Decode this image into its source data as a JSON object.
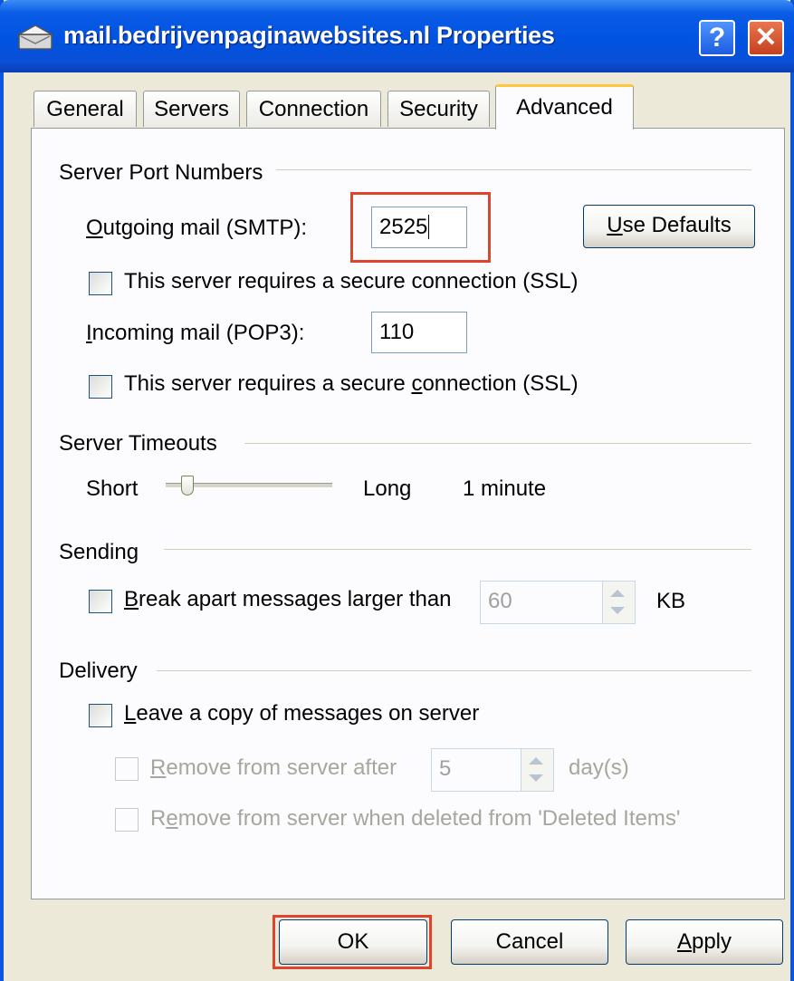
{
  "window": {
    "title": "mail.bedrijvenpaginawebsites.nl Properties",
    "help_label": "?",
    "close_label": "✕"
  },
  "tabs": [
    {
      "label": "General"
    },
    {
      "label": "Servers"
    },
    {
      "label": "Connection"
    },
    {
      "label": "Security"
    },
    {
      "label": "Advanced"
    }
  ],
  "ports": {
    "group_title": "Server Port Numbers",
    "outgoing_mnemonic": "O",
    "outgoing_rest": "utgoing mail (SMTP):",
    "outgoing_value": "2525",
    "use_defaults_mnemonic": "U",
    "use_defaults_rest": "se Defaults",
    "ssl1_label": "This server requires a secure connection (SSL)",
    "incoming_mnemonic": "I",
    "incoming_rest": "ncoming mail (POP3):",
    "incoming_value": "110",
    "ssl2_before": "This server requires a secure ",
    "ssl2_mnemonic": "c",
    "ssl2_after": "onnection (SSL)"
  },
  "timeouts": {
    "group_title": "Server Timeouts",
    "short_label": "Short",
    "long_label": "Long",
    "value_label": "1 minute",
    "slider_fraction": 0.1
  },
  "sending": {
    "group_title": "Sending",
    "break_mnemonic": "B",
    "break_rest": "reak apart messages larger than",
    "break_value": "60",
    "unit": "KB"
  },
  "delivery": {
    "group_title": "Delivery",
    "leave_mnemonic": "L",
    "leave_rest": "eave a copy of messages on server",
    "remove_mnemonic": "R",
    "remove_rest": "emove from server after",
    "remove_days_value": "5",
    "days_unit": "day(s)",
    "remove_deleted_before": "R",
    "remove_deleted_mnemonic": "e",
    "remove_deleted_after": "move from server when deleted from 'Deleted Items'"
  },
  "footer": {
    "ok_label": "OK",
    "cancel_label": "Cancel",
    "apply_mnemonic": "A",
    "apply_rest": "pply"
  },
  "colors": {
    "title_bar": "#0053e1",
    "highlight": "#e0432b",
    "dialog_face": "#ece9d8"
  }
}
